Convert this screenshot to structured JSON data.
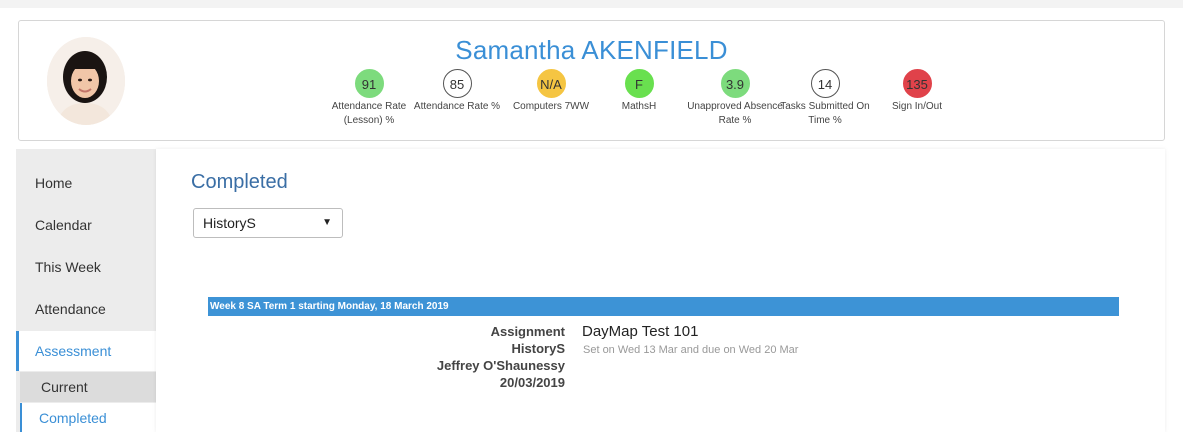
{
  "student": {
    "name": "Samantha AKENFIELD"
  },
  "metrics": [
    {
      "value": "91",
      "label": "Attendance Rate (Lesson) %",
      "color": "#7ddb7d",
      "border": "#7ddb7d"
    },
    {
      "value": "85",
      "label": "Attendance Rate %",
      "color": "#ffffff",
      "border": "#555555"
    },
    {
      "value": "N/A",
      "label": "Computers 7WW",
      "color": "#f5c542",
      "border": "#f5c542"
    },
    {
      "value": "F",
      "label": "MathsH",
      "color": "#69e04f",
      "border": "#69e04f"
    },
    {
      "value": "3.9",
      "label": "Unapproved Absence Rate %",
      "color": "#7ddb7d",
      "border": "#7ddb7d"
    },
    {
      "value": "14",
      "label": "Tasks Submitted On Time %",
      "color": "#ffffff",
      "border": "#555555"
    },
    {
      "value": "135",
      "label": "Sign In/Out",
      "color": "#e0424a",
      "border": "#e0424a"
    }
  ],
  "nav": {
    "items": [
      "Home",
      "Calendar",
      "This Week",
      "Attendance",
      "Assessment"
    ],
    "active": "Assessment",
    "sub_items": [
      "Current",
      "Completed"
    ],
    "active_sub": "Completed"
  },
  "main": {
    "title": "Completed",
    "subject_select": "HistoryS",
    "week_header": "Week 8 SA Term 1 starting Monday, 18 March 2019",
    "task": {
      "type": "Assignment",
      "subject": "HistoryS",
      "teacher": "Jeffrey O'Shaunessy",
      "date": "20/03/2019",
      "title": "DayMap Test 101",
      "details": "Set on Wed 13 Mar and due on Wed 20 Mar"
    }
  }
}
